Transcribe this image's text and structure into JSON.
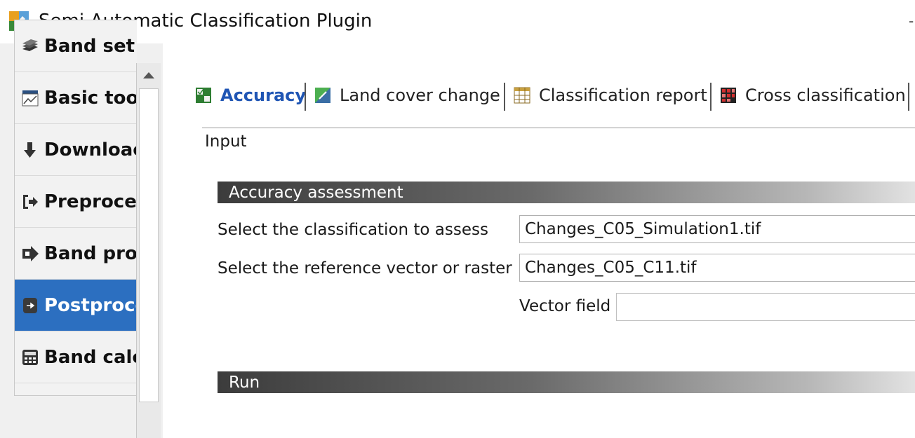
{
  "window": {
    "title": "Semi-Automatic Classification Plugin",
    "app_icon": "scp-plugin-icon",
    "title_glyph": "-"
  },
  "sidebar": {
    "items": [
      {
        "label": "Band set",
        "icon": "layers-icon",
        "active": false
      },
      {
        "label": "Basic tool",
        "icon": "basic-tools-icon",
        "active": false
      },
      {
        "label": "Downloac",
        "icon": "download-icon",
        "active": false
      },
      {
        "label": "Preproce:",
        "icon": "preprocessing-icon",
        "active": false
      },
      {
        "label": "Band pro",
        "icon": "band-processing-icon",
        "active": false
      },
      {
        "label": "Postproce",
        "icon": "postprocessing-icon",
        "active": true
      },
      {
        "label": "Band calc",
        "icon": "calculator-icon",
        "active": false
      }
    ]
  },
  "tabs": [
    {
      "label": "Accuracy",
      "icon": "accuracy-icon",
      "active": true
    },
    {
      "label": "Land cover change",
      "icon": "land-cover-change-icon",
      "active": false
    },
    {
      "label": "Classification report",
      "icon": "classification-report-icon",
      "active": false
    },
    {
      "label": "Cross classification",
      "icon": "cross-classification-icon",
      "active": false
    }
  ],
  "main": {
    "section_label": "Input",
    "accuracy_group": {
      "title": "Accuracy assessment",
      "classification_label": "Select the classification to assess",
      "classification_value": "Changes_C05_Simulation1.tif",
      "reference_label": "Select the reference vector or raster",
      "reference_value": "Changes_C05_C11.tif",
      "vector_field_label": "Vector field",
      "vector_field_value": ""
    },
    "run_group": {
      "title": "Run"
    }
  },
  "colors": {
    "active_nav": "#2c6fc0",
    "active_tab_text": "#1f55b4",
    "header_dark": "#3c3c3c"
  }
}
